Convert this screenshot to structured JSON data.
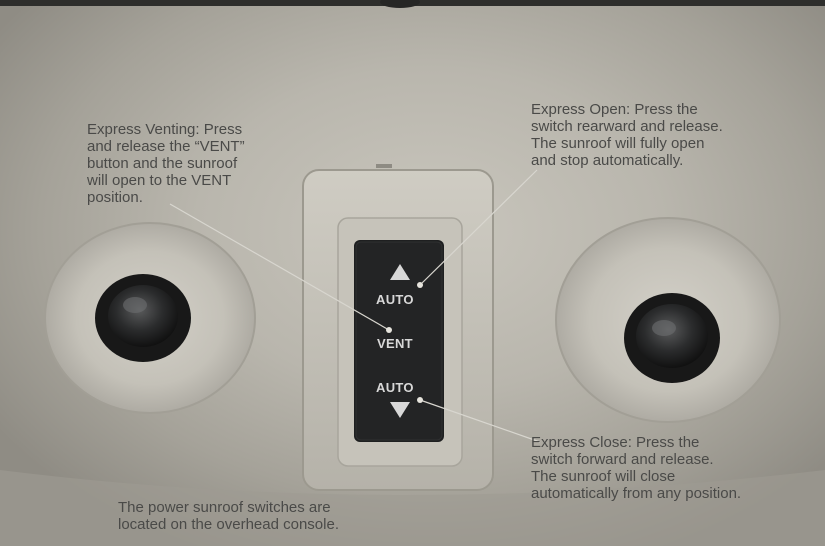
{
  "callouts": {
    "express_venting": "Express Venting: Press\nand release the “VENT”\nbutton and the sunroof\nwill open to the VENT\nposition.",
    "express_open": "Express Open: Press the\nswitch rearward and release.\nThe sunroof will fully open\nand stop automatically.",
    "express_close": "Express Close: Press the\nswitch forward and release.\nThe sunroof will close\nautomatically from any position.",
    "caption": "The power sunroof switches are\nlocated on the overhead console."
  },
  "switch_labels": {
    "auto_up": "AUTO",
    "vent": "VENT",
    "auto_down": "AUTO"
  },
  "colors": {
    "headliner": "#bdb9b0",
    "switch_body": "#1e1f20",
    "callout_text": "#4a4a48",
    "leader_line": "#d8d6cf"
  }
}
